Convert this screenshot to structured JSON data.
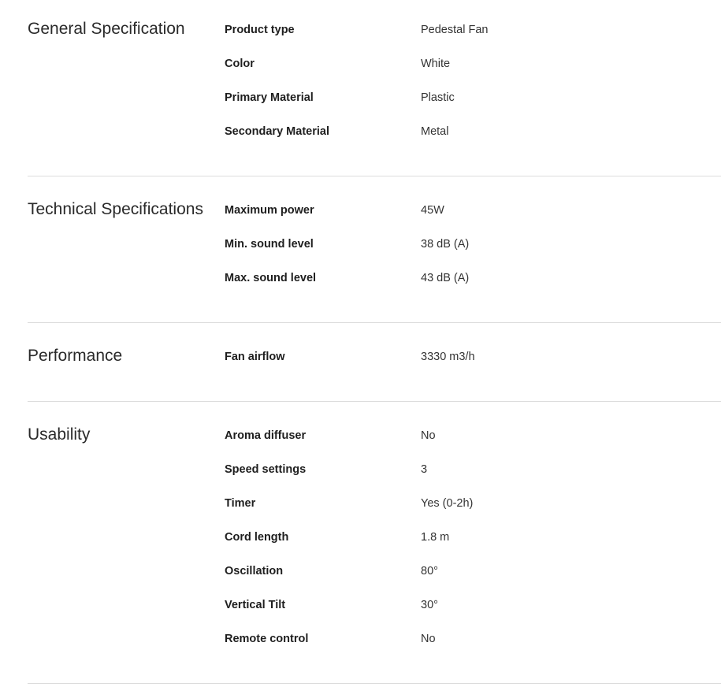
{
  "sections": [
    {
      "title": "General Specification",
      "rows": [
        {
          "label": "Product type",
          "value": "Pedestal Fan"
        },
        {
          "label": "Color",
          "value": "White"
        },
        {
          "label": "Primary Material",
          "value": "Plastic"
        },
        {
          "label": "Secondary Material",
          "value": "Metal"
        }
      ]
    },
    {
      "title": "Technical Specifications",
      "rows": [
        {
          "label": "Maximum power",
          "value": "45W"
        },
        {
          "label": "Min. sound level",
          "value": "38 dB (A)"
        },
        {
          "label": "Max. sound level",
          "value": "43 dB (A)"
        }
      ]
    },
    {
      "title": "Performance",
      "rows": [
        {
          "label": "Fan airflow",
          "value": "3330 m3/h"
        }
      ]
    },
    {
      "title": "Usability",
      "rows": [
        {
          "label": "Aroma diffuser",
          "value": "No"
        },
        {
          "label": "Speed settings",
          "value": "3"
        },
        {
          "label": "Timer",
          "value": "Yes (0-2h)"
        },
        {
          "label": "Cord length",
          "value": "1.8 m"
        },
        {
          "label": "Oscillation",
          "value": "80°"
        },
        {
          "label": "Vertical Tilt",
          "value": "30°"
        },
        {
          "label": "Remote control",
          "value": "No"
        }
      ]
    }
  ]
}
